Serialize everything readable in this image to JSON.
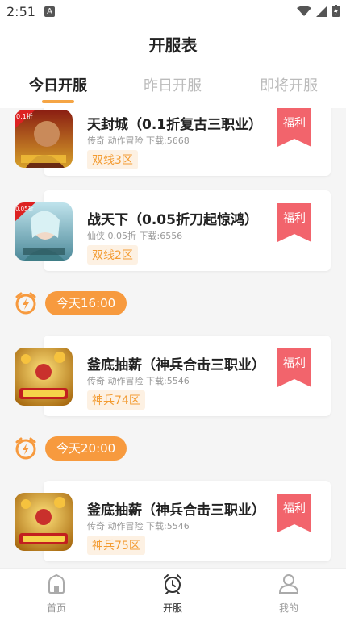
{
  "status": {
    "time": "2:51",
    "sim_label": "A"
  },
  "header": {
    "title": "开服表"
  },
  "tabs": [
    {
      "label": "今日开服",
      "active": true
    },
    {
      "label": "昨日开服",
      "active": false
    },
    {
      "label": "即将开服",
      "active": false
    }
  ],
  "groups": [
    {
      "time": "",
      "servers": [
        {
          "name": "天封城（0.1折复古三职业）",
          "meta": "传奇 动作冒险 下载:5668",
          "zone": "双线3区",
          "tag": "福利",
          "icon": "game-icon-tianfengcheng",
          "badge": "0.1折"
        },
        {
          "name": "战天下（0.05折刀起惊鸿）",
          "meta": "仙侠 0.05折 下载:6556",
          "zone": "双线2区",
          "tag": "福利",
          "icon": "game-icon-zhantianxia",
          "badge": "0.05折"
        }
      ]
    },
    {
      "time": "今天16:00",
      "servers": [
        {
          "name": "釜底抽薪（神兵合击三职业）",
          "meta": "传奇 动作冒险 下载:5546",
          "zone": "神兵74区",
          "tag": "福利",
          "icon": "game-icon-fudichouxin",
          "badge": ""
        }
      ]
    },
    {
      "time": "今天20:00",
      "servers": [
        {
          "name": "釜底抽薪（神兵合击三职业）",
          "meta": "传奇 动作冒险 下载:5546",
          "zone": "神兵75区",
          "tag": "福利",
          "icon": "game-icon-fudichouxin",
          "badge": ""
        }
      ]
    }
  ],
  "bottom_nav": [
    {
      "label": "首页",
      "icon": "home-icon",
      "active": false
    },
    {
      "label": "开服",
      "icon": "alarm-clock-icon",
      "active": true
    },
    {
      "label": "我的",
      "icon": "user-icon",
      "active": false
    }
  ],
  "colors": {
    "accent": "#f79a3e",
    "welfare": "#f2646c",
    "zone_text": "#f39c33",
    "zone_bg": "#fdf1e3"
  }
}
